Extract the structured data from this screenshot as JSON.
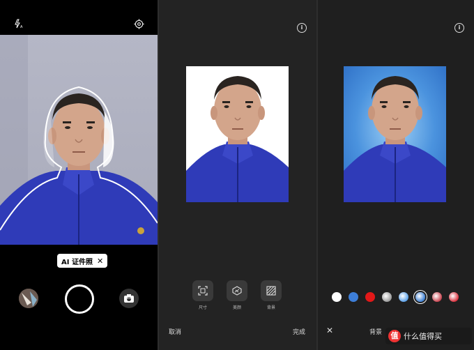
{
  "camera": {
    "chip_label": "AI 证件照",
    "chip_close": "✕"
  },
  "editor": {
    "info": "i",
    "tools": [
      {
        "label": "尺寸",
        "icon": "crop-frame-icon"
      },
      {
        "label": "美颜",
        "icon": "beauty-face-icon"
      },
      {
        "label": "背景",
        "icon": "background-pattern-icon"
      }
    ],
    "cancel": "取消",
    "done": "完成"
  },
  "background": {
    "info": "i",
    "close": "✕",
    "label": "背景",
    "swatches": [
      {
        "name": "white",
        "color": "#ffffff",
        "selected": false
      },
      {
        "name": "blue",
        "color": "#3d7ed8",
        "selected": false
      },
      {
        "name": "red",
        "color": "#e21818",
        "selected": false
      },
      {
        "name": "gray-gradient",
        "color": "#9a9a9a",
        "selected": false
      },
      {
        "name": "light-blue-gradient",
        "color": "#5aa0e8",
        "selected": false
      },
      {
        "name": "blue-gradient",
        "color": "#3b7fd4",
        "selected": true
      },
      {
        "name": "rose-gradient",
        "color": "#c8434f",
        "selected": false
      },
      {
        "name": "red-gradient",
        "color": "#d8303d",
        "selected": false
      }
    ]
  },
  "watermark": {
    "badge": "值",
    "text": "什么值得买"
  }
}
